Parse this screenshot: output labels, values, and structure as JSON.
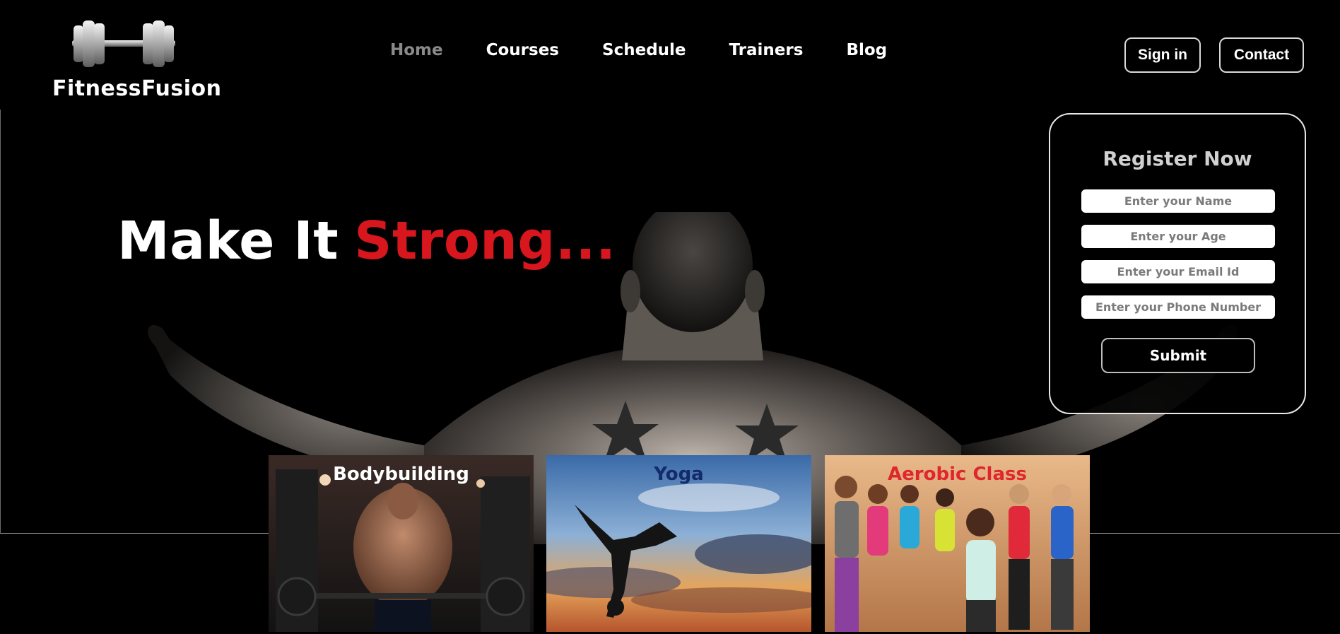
{
  "brand": {
    "name": "FitnessFusion",
    "logo_icon": "dumbbell-icon"
  },
  "nav": {
    "items": [
      {
        "label": "Home",
        "active": true
      },
      {
        "label": "Courses",
        "active": false
      },
      {
        "label": "Schedule",
        "active": false
      },
      {
        "label": "Trainers",
        "active": false
      },
      {
        "label": "Blog",
        "active": false
      }
    ]
  },
  "header_buttons": {
    "signin": "Sign in",
    "contact": "Contact"
  },
  "hero": {
    "headline_white": "Make It",
    "headline_red": "Strong..."
  },
  "register": {
    "title": "Register Now",
    "fields": [
      {
        "placeholder": "Enter your Name"
      },
      {
        "placeholder": "Enter your Age"
      },
      {
        "placeholder": "Enter your Email Id"
      },
      {
        "placeholder": "Enter your Phone Number"
      }
    ],
    "submit_label": "Submit"
  },
  "courses": [
    {
      "title": "Bodybuilding"
    },
    {
      "title": "Yoga"
    },
    {
      "title": "Aerobic Class"
    }
  ],
  "colors": {
    "accent_red": "#d7161d",
    "background": "#000000",
    "nav_active": "#8a8a8a"
  }
}
